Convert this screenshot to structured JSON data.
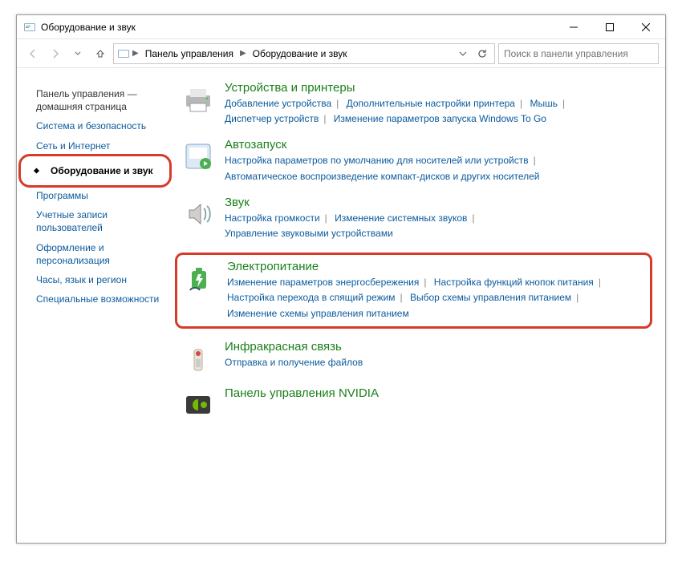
{
  "window": {
    "title": "Оборудование и звук"
  },
  "breadcrumb": {
    "root": "Панель управления",
    "current": "Оборудование и звук"
  },
  "search": {
    "placeholder": "Поиск в панели управления"
  },
  "sidebar": {
    "items": [
      "Панель управления — домашняя страница",
      "Система и безопасность",
      "Сеть и Интернет",
      "Оборудование и звук",
      "Программы",
      "Учетные записи пользователей",
      "Оформление и персонализация",
      "Часы, язык и регион",
      "Специальные возможности"
    ]
  },
  "categories": [
    {
      "title": "Устройства и принтеры",
      "links": [
        "Добавление устройства",
        "Дополнительные настройки принтера",
        "Мышь",
        "Диспетчер устройств",
        "Изменение параметров запуска Windows To Go"
      ]
    },
    {
      "title": "Автозапуск",
      "links": [
        "Настройка параметров по умолчанию для носителей или устройств",
        "Автоматическое воспроизведение компакт-дисков и других носителей"
      ]
    },
    {
      "title": "Звук",
      "links": [
        "Настройка громкости",
        "Изменение системных звуков",
        "Управление звуковыми устройствами"
      ]
    },
    {
      "title": "Электропитание",
      "links": [
        "Изменение параметров энергосбережения",
        "Настройка функций кнопок питания",
        "Настройка перехода в спящий режим",
        "Выбор схемы управления питанием",
        "Изменение схемы управления питанием"
      ]
    },
    {
      "title": "Инфракрасная связь",
      "links": [
        "Отправка и получение файлов"
      ]
    },
    {
      "title": "Панель управления NVIDIA",
      "links": []
    }
  ]
}
